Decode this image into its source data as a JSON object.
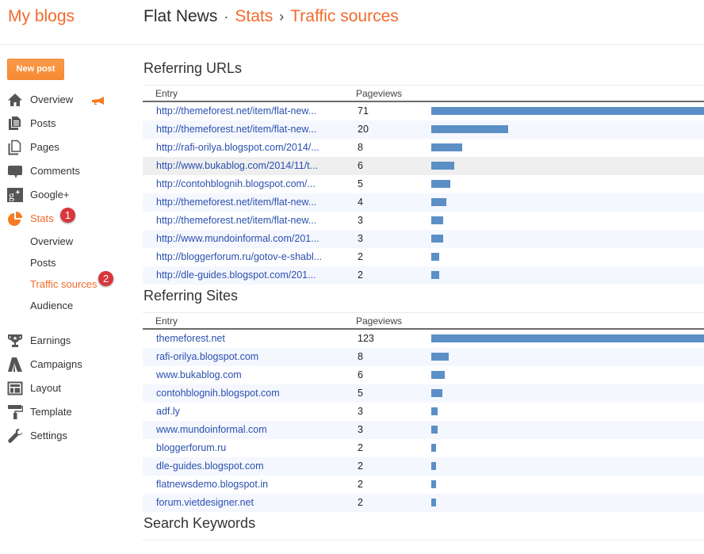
{
  "header": {
    "my_blogs": "My blogs",
    "blog_name": "Flat News",
    "sep_dot": "·",
    "crumb_stats": "Stats",
    "sep_arrow": "›",
    "crumb_current": "Traffic sources"
  },
  "sidebar": {
    "new_post": "New post",
    "items": [
      {
        "label": "Overview",
        "icon": "home-icon"
      },
      {
        "label": "Posts",
        "icon": "posts-icon"
      },
      {
        "label": "Pages",
        "icon": "pages-icon"
      },
      {
        "label": "Comments",
        "icon": "comments-icon"
      },
      {
        "label": "Google+",
        "icon": "google-plus-icon"
      },
      {
        "label": "Stats",
        "icon": "stats-pie-icon",
        "active": true
      },
      {
        "label": "Earnings",
        "icon": "trophy-icon"
      },
      {
        "label": "Campaigns",
        "icon": "campaigns-icon"
      },
      {
        "label": "Layout",
        "icon": "layout-icon"
      },
      {
        "label": "Template",
        "icon": "paint-roller-icon"
      },
      {
        "label": "Settings",
        "icon": "wrench-icon"
      }
    ],
    "stats_subitems": [
      {
        "label": "Overview"
      },
      {
        "label": "Posts"
      },
      {
        "label": "Traffic sources",
        "active": true
      },
      {
        "label": "Audience"
      }
    ],
    "badges": [
      "1",
      "2"
    ]
  },
  "colors": {
    "accent": "#f36a2c",
    "button": "#f78a33",
    "link": "#2a50ae",
    "bar": "#5b8fc6",
    "badge": "#d8363d",
    "row_alt": "#f5f7ff",
    "row_hover": "#efefef"
  },
  "sections": [
    {
      "title": "Referring URLs",
      "col_entry": "Entry",
      "col_pageviews": "Pageviews",
      "rows": [
        {
          "entry": "http://themeforest.net/item/flat-new...",
          "pageviews": 71
        },
        {
          "entry": "http://themeforest.net/item/flat-new...",
          "pageviews": 20
        },
        {
          "entry": "http://rafi-orilya.blogspot.com/2014/...",
          "pageviews": 8
        },
        {
          "entry": "http://www.bukablog.com/2014/11/t...",
          "pageviews": 6,
          "hover": true
        },
        {
          "entry": "http://contohblognih.blogspot.com/...",
          "pageviews": 5
        },
        {
          "entry": "http://themeforest.net/item/flat-new...",
          "pageviews": 4
        },
        {
          "entry": "http://themeforest.net/item/flat-new...",
          "pageviews": 3
        },
        {
          "entry": "http://www.mundoinformal.com/201...",
          "pageviews": 3
        },
        {
          "entry": "http://bloggerforum.ru/gotov-e-shabl...",
          "pageviews": 2
        },
        {
          "entry": "http://dle-guides.blogspot.com/201...",
          "pageviews": 2
        }
      ]
    },
    {
      "title": "Referring Sites",
      "col_entry": "Entry",
      "col_pageviews": "Pageviews",
      "rows": [
        {
          "entry": "themeforest.net",
          "pageviews": 123
        },
        {
          "entry": "rafi-orilya.blogspot.com",
          "pageviews": 8
        },
        {
          "entry": "www.bukablog.com",
          "pageviews": 6
        },
        {
          "entry": "contohblognih.blogspot.com",
          "pageviews": 5
        },
        {
          "entry": "adf.ly",
          "pageviews": 3
        },
        {
          "entry": "www.mundoinformal.com",
          "pageviews": 3
        },
        {
          "entry": "bloggerforum.ru",
          "pageviews": 2
        },
        {
          "entry": "dle-guides.blogspot.com",
          "pageviews": 2
        },
        {
          "entry": "flatnewsdemo.blogspot.in",
          "pageviews": 2
        },
        {
          "entry": "forum.vietdesigner.net",
          "pageviews": 2
        }
      ]
    },
    {
      "title": "Search Keywords"
    }
  ]
}
